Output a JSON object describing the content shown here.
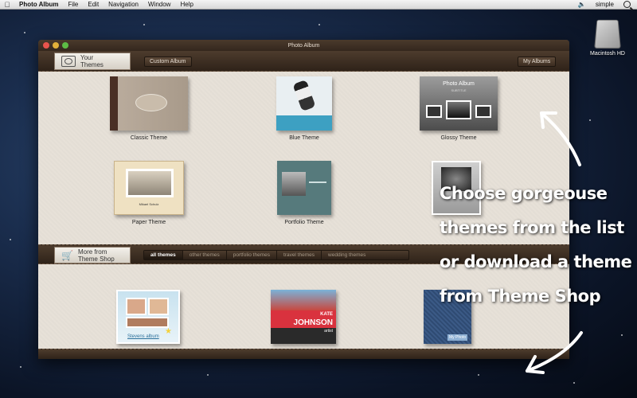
{
  "menubar": {
    "apple_icon": "apple-logo-icon",
    "items": [
      "Photo Album",
      "File",
      "Edit",
      "Navigation",
      "Window",
      "Help"
    ],
    "volume_icon": "speaker-icon",
    "user": "simple",
    "spotlight_icon": "search-icon"
  },
  "desktop": {
    "hd_label": "Macintosh HD"
  },
  "window": {
    "title": "Photo Album",
    "toolbar": {
      "your_themes_line1": "Your",
      "your_themes_line2": "Themes",
      "custom_album": "Custom Album",
      "my_albums": "My Albums"
    },
    "themes": [
      {
        "name": "Classic Theme"
      },
      {
        "name": "Blue Theme"
      },
      {
        "name": "Glossy Theme",
        "cover_title": "Photo Album",
        "cover_subtitle": "SUBTITLE"
      },
      {
        "name": "Paper Theme",
        "cover_name": "Mikael Schulz"
      },
      {
        "name": "Portfolio Theme"
      }
    ],
    "shop": {
      "more_line1": "More from",
      "more_line2": "Theme Shop",
      "filters": [
        "all themes",
        "other themes",
        "portfolio themes",
        "travel themes",
        "wedding themes"
      ],
      "active_filter": "all themes",
      "items": [
        {
          "cover_name": "Stevens album"
        },
        {
          "cover_top": "KATE",
          "cover_name": "JOHNSON",
          "cover_role": "artist"
        },
        {
          "cover_tag": "My Photo"
        }
      ]
    }
  },
  "overlay": {
    "line1": "Choose gorgeouse",
    "line2": "themes from the list",
    "line3": "or download a theme",
    "line4": "from Theme Shop"
  },
  "colors": {
    "window_frame": "#3b2d22",
    "panel_bg": "#e7e1d8",
    "overlay_text": "#ffffff"
  }
}
